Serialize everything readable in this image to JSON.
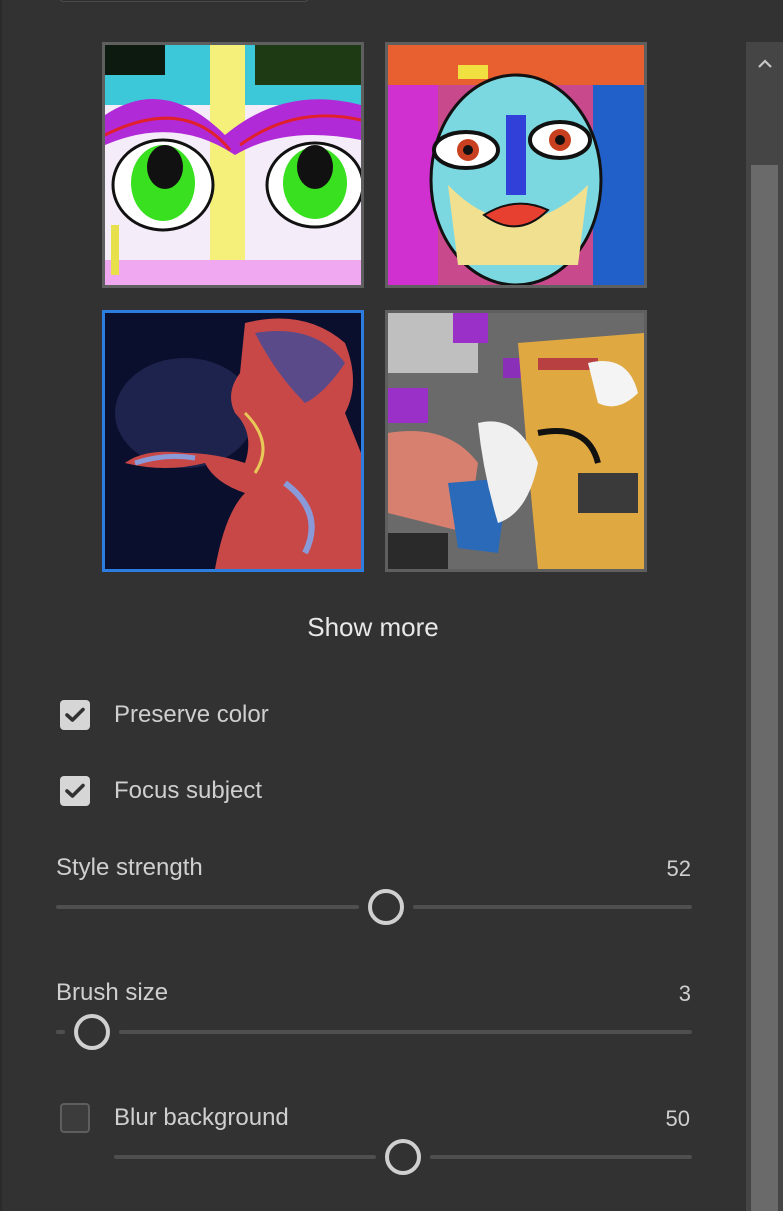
{
  "gallery": {
    "thumbnails": [
      {
        "name": "pop-art-eyes",
        "selected": false
      },
      {
        "name": "pop-art-face",
        "selected": false
      },
      {
        "name": "neon-figure",
        "selected": true
      },
      {
        "name": "cubist-abstract",
        "selected": false
      }
    ],
    "show_more_label": "Show more"
  },
  "options": {
    "preserve_color": {
      "label": "Preserve color",
      "checked": true
    },
    "focus_subject": {
      "label": "Focus subject",
      "checked": true
    }
  },
  "sliders": {
    "style_strength": {
      "label": "Style strength",
      "value": "52",
      "fraction": 0.52
    },
    "brush_size": {
      "label": "Brush size",
      "value": "3",
      "fraction": 0.03
    },
    "blur_background": {
      "label": "Blur background",
      "value": "50",
      "fraction": 0.5,
      "checked": false
    }
  },
  "colors": {
    "selected_border": "#2b7ee0",
    "panel_bg": "#323232"
  },
  "icons": {
    "checkmark": "check-icon",
    "scroll_up": "chevron-up-icon"
  }
}
